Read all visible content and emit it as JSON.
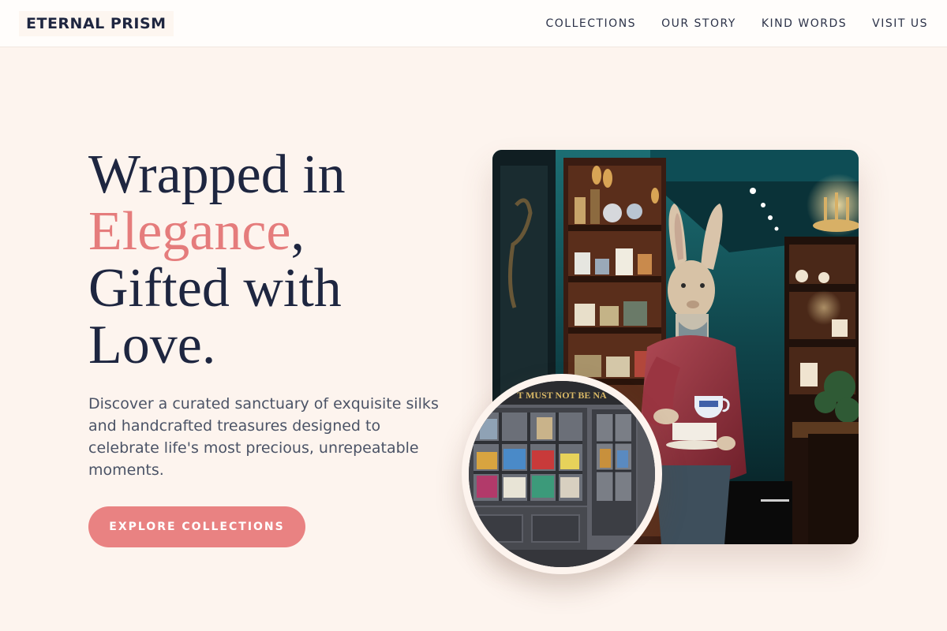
{
  "brand": {
    "name": "ETERNAL PRISM"
  },
  "nav": {
    "items": [
      {
        "label": "COLLECTIONS"
      },
      {
        "label": "OUR STORY"
      },
      {
        "label": "KIND WORDS"
      },
      {
        "label": "VISIT US"
      }
    ]
  },
  "hero": {
    "title_line1": "Wrapped in",
    "title_accent": "Elegance",
    "title_comma": ",",
    "title_line3": "Gifted with",
    "title_line4": "Love.",
    "description": "Discover a curated sanctuary of exquisite silks and handcrafted treasures designed to celebrate life's most precious, unrepeatable moments.",
    "cta_label": "EXPLORE COLLECTIONS"
  },
  "images": {
    "main_photo_sign": "",
    "storefront_sign": "T MUST NOT BE NA"
  },
  "colors": {
    "background": "#fdf4ee",
    "accent": "#e57c7c",
    "button": "#e98282",
    "heading": "#1e2640",
    "body_text": "#4b5366"
  }
}
